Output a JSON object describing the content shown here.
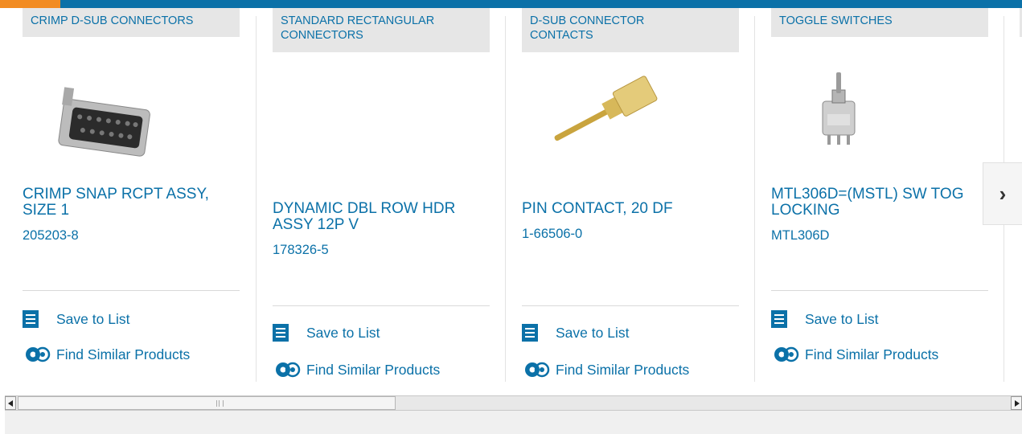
{
  "colors": {
    "brand_blue": "#0b71a8",
    "accent_orange": "#f28c22"
  },
  "cards": [
    {
      "category": "CRIMP D-SUB CONNECTORS",
      "name_lines": [
        "CRIMP SNAP RCPT ASSY,",
        "SIZE 1"
      ],
      "part_number": "205203-8",
      "save_label": "Save to List",
      "similar_label": "Find Similar Products",
      "image": "d-sub-connector"
    },
    {
      "category_lines": [
        "STANDARD RECTANGULAR",
        "CONNECTORS"
      ],
      "name_lines": [
        "DYNAMIC DBL ROW HDR",
        "ASSY 12P V"
      ],
      "part_number": "178326-5",
      "save_label": "Save to List",
      "similar_label": "Find Similar Products",
      "image": ""
    },
    {
      "category_lines": [
        "D-SUB CONNECTOR",
        "CONTACTS"
      ],
      "name_lines": [
        "PIN CONTACT, 20 DF"
      ],
      "part_number": "1-66506-0",
      "save_label": "Save to List",
      "similar_label": "Find Similar Products",
      "image": "pin-contact"
    },
    {
      "category": "TOGGLE SWITCHES",
      "name_lines": [
        "MTL306D=(MSTL) SW TOG",
        "LOCKING"
      ],
      "part_number": "MTL306D",
      "save_label": "Save to List",
      "similar_label": "Find Similar Products",
      "image": "toggle-switch"
    }
  ],
  "carousel": {
    "next_label": "›"
  }
}
